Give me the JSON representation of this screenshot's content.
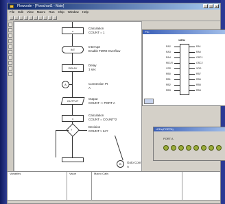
{
  "window": {
    "title": "Flowcode - [Flowchart1 - Main]"
  },
  "menu": [
    "File",
    "Edit",
    "View",
    "Macro",
    "Run",
    "Chip",
    "Window",
    "Help"
  ],
  "flowchart": {
    "steps": [
      {
        "shape": "rect",
        "text": "x",
        "desc": "Calculation\nCOUNT = 1"
      },
      {
        "shape": "oval",
        "text": "INT",
        "desc": "Interrupt\nEnable TMR0 Overflow"
      },
      {
        "shape": "rect",
        "text": "DELAY",
        "desc": "Delay\n1 sec"
      },
      {
        "shape": "circ",
        "text": "A",
        "desc": "Connection Pt\nA"
      },
      {
        "shape": "para",
        "text": "OUTPUT",
        "desc": "Output\nCOUNT -> PORT A"
      },
      {
        "shape": "rect",
        "text": "x",
        "desc": "Calculation\nCOUNT = COUNT*2"
      },
      {
        "shape": "diam",
        "text": "?",
        "desc": "Decision\nCOUNT > 64?"
      },
      {
        "shape": "circ",
        "text": "B",
        "desc": "Goto Connection Pt\nA"
      }
    ]
  },
  "chip": {
    "title": "PIC",
    "part": "16F84",
    "left_pins": [
      "RA2",
      "RA3",
      "RA4",
      "MCLR",
      "VSS",
      "RB0",
      "RB1",
      "RB2",
      "RB3"
    ],
    "right_pins": [
      "RA1",
      "RA0",
      "OSC1",
      "OSC2",
      "VDD",
      "RB7",
      "RB6",
      "RB5",
      "RB4"
    ]
  },
  "led_panel": {
    "title": "LEDs(PORTA)",
    "label": "PORT A",
    "leds": 8,
    "led_color": "#9aac3a"
  },
  "bottom_panel": {
    "columns": [
      "Variables",
      "Value",
      "Macro Calls"
    ]
  },
  "colors": {
    "desktop": "#1f2f86",
    "titlebar": "#0a246a",
    "window_bg": "#d4d0c8"
  }
}
